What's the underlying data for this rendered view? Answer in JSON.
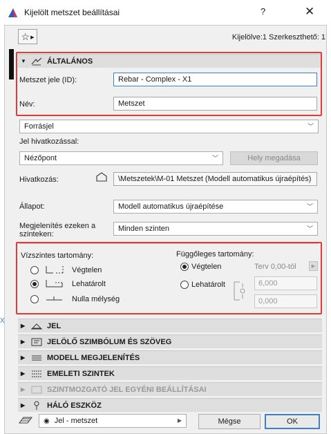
{
  "window": {
    "title": "Kijelölt metszet beállításai",
    "help": "?",
    "close": "✕",
    "selection_info": "Kijelölve:1 Szerkeszthető: 1"
  },
  "sections": {
    "general": "ÁLTALÁNOS",
    "marker": "JEL",
    "marker_symbol_text": "JELÖLŐ SZIMBÓLUM ÉS SZÖVEG",
    "model_display": "MODELL MEGJELENÍTÉS",
    "floor_levels": "EMELETI SZINTEK",
    "level_marker_custom": "SZINTMOZGATÓ JEL EGYÉNI BEÁLLÍTÁSAI",
    "grid_tool": "HÁLÓ ESZKÖZ"
  },
  "general": {
    "id_label": "Metszet jele (ID):",
    "id_value": "Rebar - Complex - X1",
    "name_label": "Név:",
    "name_value": "Metszet",
    "source_marker": "Forrásjel",
    "ref_marker_label": "Jel hivatkozással:",
    "ref_marker_value": "Nézőpont",
    "locate_button": "Hely megadása",
    "reference_label": "Hivatkozás:",
    "reference_value": "\\Metszetek\\M-01 Metszet (Modell automatikus újraépítés)",
    "status_label": "Állapot:",
    "status_value": "Modell automatikus újraépítése",
    "show_on_label": "Megjelenítés ezeken a szinteken:",
    "show_on_value": "Minden szinten"
  },
  "horizontal": {
    "title": "Vízszintes tartomány:",
    "options": [
      "Végtelen",
      "Lehatárolt",
      "Nulla mélység"
    ],
    "selected": 1
  },
  "vertical": {
    "title": "Függőleges tartomány:",
    "options": [
      "Végtelen",
      "Lehatárolt"
    ],
    "selected": 0,
    "plan_offset_label": "Terv 0,00-tól",
    "top_value": "6,000",
    "bottom_value": "0,000"
  },
  "footer": {
    "layer_value": "Jel - metszet",
    "cancel": "Mégse",
    "ok": "OK"
  },
  "colors": {
    "highlight": "#e03a3a",
    "focus": "#3c7fd1"
  }
}
